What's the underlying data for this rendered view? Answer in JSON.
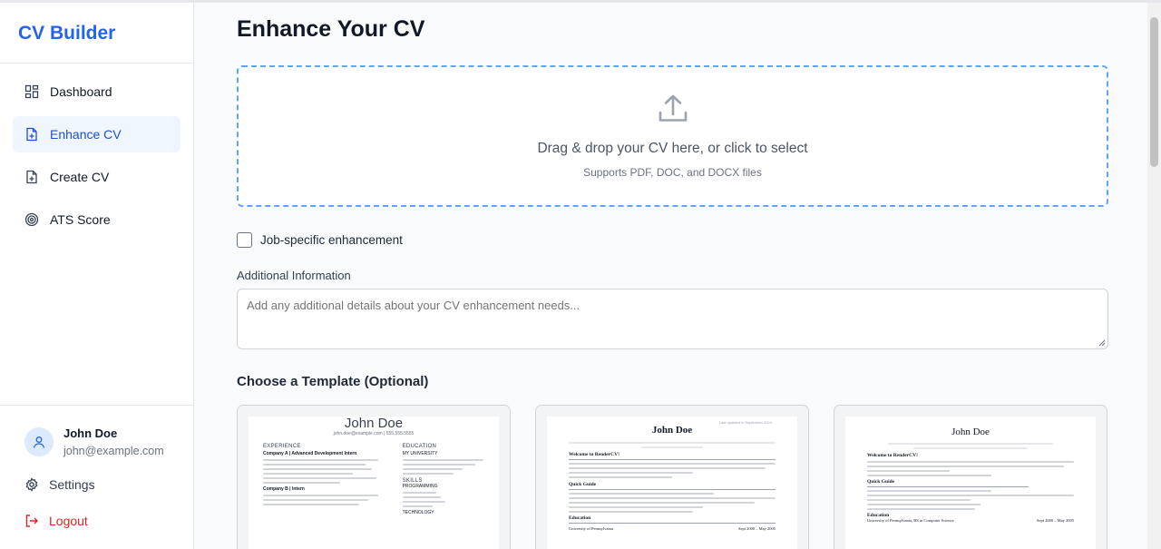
{
  "brand": "CV Builder",
  "nav": {
    "dashboard": "Dashboard",
    "enhance": "Enhance CV",
    "create": "Create CV",
    "ats": "ATS Score"
  },
  "user": {
    "name": "John Doe",
    "email": "john@example.com"
  },
  "settings_label": "Settings",
  "logout_label": "Logout",
  "page_title": "Enhance Your CV",
  "dropzone": {
    "title": "Drag & drop your CV here, or click to select",
    "subtitle": "Supports PDF, DOC, and DOCX files"
  },
  "job_specific_label": "Job-specific enhancement",
  "job_specific_checked": false,
  "additional": {
    "label": "Additional Information",
    "placeholder": "Add any additional details about your CV enhancement needs..."
  },
  "templates_heading": "Choose a Template (Optional)",
  "templates": [
    {
      "name": "John Doe",
      "contact": "john.doe@example.com | 555.555.5555",
      "left_heading": "Experience",
      "right_heading": "Education",
      "right_sub": "My University",
      "skills_heading": "Skills",
      "skills_sub": "Programming",
      "company_a": "Company A | Advanced Development Intern",
      "company_b": "Company B | Intern",
      "technology": "Technology"
    },
    {
      "name": "John Doe",
      "updated": "Last updated in September 2024",
      "welcome": "Welcome to RenderCV!",
      "quick": "Quick Guide",
      "education": "Education",
      "university": "University of Pennsylvania",
      "dates": "Sept 2000 – May 2005"
    },
    {
      "name": "John Doe",
      "welcome": "Welcome to RenderCV!",
      "quick": "Quick Guide",
      "education": "Education",
      "university": "University of Pennsylvania, BS in Computer Science",
      "dates": "Sept 2000 – May 2005"
    }
  ],
  "colors": {
    "brand": "#2563eb",
    "active_bg": "#eff6ff",
    "dropzone_border": "#60a5fa",
    "logout": "#dc2626"
  }
}
